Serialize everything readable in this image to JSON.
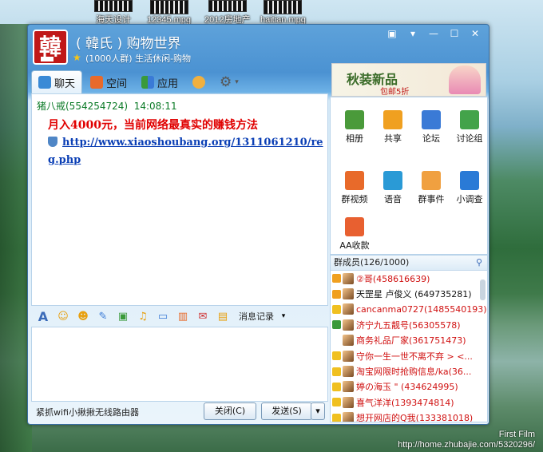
{
  "desktop": {
    "files": [
      "海天设计",
      "12345.mpg",
      "2012房地产",
      "haitian.mpg"
    ],
    "watermark_line1": "First Film",
    "watermark_line2": "http://home.zhubajie.com/5320296/"
  },
  "window": {
    "logo_char": "韓",
    "title": "( 韓氏 ) 购物世界",
    "subtitle": "(1000人群) 生活休闲-购物",
    "controls": [
      "▣",
      "▾",
      "—",
      "☐",
      "✕"
    ],
    "ad": {
      "title": "秋装新品",
      "sub": "包邮5折"
    }
  },
  "tabs": [
    {
      "label": "聊天",
      "icon": "chat-icon"
    },
    {
      "label": "空间",
      "icon": "home-icon"
    },
    {
      "label": "应用",
      "icon": "apps-icon"
    }
  ],
  "chat": {
    "sender": "猪八戒(554254724)",
    "time": "14:08:11",
    "message": "月入4000元，当前网络最真实的赚钱方法",
    "link": "http://www.xiaoshoubang.org/1311061210/reg.php"
  },
  "chat_toolbar": {
    "history_label": "消息记录"
  },
  "bottom_bar": {
    "promo": "紧抓wifi小揪揪无线路由器",
    "close_label": "关闭(C)",
    "send_label": "发送(S)"
  },
  "apps": [
    {
      "label": "相册",
      "color": "#4a9a3a",
      "icon": "album-icon"
    },
    {
      "label": "共享",
      "color": "#f0a020",
      "icon": "share-icon"
    },
    {
      "label": "论坛",
      "color": "#3a7ad6",
      "icon": "forum-icon"
    },
    {
      "label": "讨论组",
      "color": "#43a34a",
      "icon": "discussion-icon"
    },
    {
      "label": "群视频",
      "color": "#e86a2a",
      "icon": "video-icon"
    },
    {
      "label": "语音",
      "color": "#2a9ad6",
      "icon": "voice-icon"
    },
    {
      "label": "群事件",
      "color": "#f0a040",
      "icon": "event-icon"
    },
    {
      "label": "小调查",
      "color": "#2a7ad6",
      "icon": "survey-icon"
    },
    {
      "label": "AA收款",
      "color": "#e86030",
      "icon": "payment-icon"
    }
  ],
  "members": {
    "header": "群成员(126/1000)",
    "list": [
      {
        "name": "②哥(458616639)",
        "color": "#d01010",
        "badge": "#f0a020"
      },
      {
        "name": "天罡星  卢俊义 (649735281)",
        "color": "#111111",
        "badge": "#f0a020"
      },
      {
        "name": "cancanma0727(1485540193)",
        "color": "#d01010",
        "badge": "#f0c020"
      },
      {
        "name": "济宁九五靓号(56305578)",
        "color": "#d01010",
        "badge": "#3a9a3a"
      },
      {
        "name": "商务礼品厂家(361751473)",
        "color": "#d01010",
        "badge": ""
      },
      {
        "name": "守你一生一世不离不弃 >  <...",
        "color": "#d01010",
        "badge": "#f0c020"
      },
      {
        "name": "淘宝网限时抢购信息/ka(36...",
        "color": "#d01010",
        "badge": "#f0c020"
      },
      {
        "name": "婷の海玉 \" (434624995)",
        "color": "#d01010",
        "badge": "#f0c020"
      },
      {
        "name": "喜气洋洋(1393474814)",
        "color": "#d01010",
        "badge": "#f0c020"
      },
      {
        "name": "想开网店的Q我(133381018)",
        "color": "#d01010",
        "badge": "#f0c020"
      }
    ]
  }
}
